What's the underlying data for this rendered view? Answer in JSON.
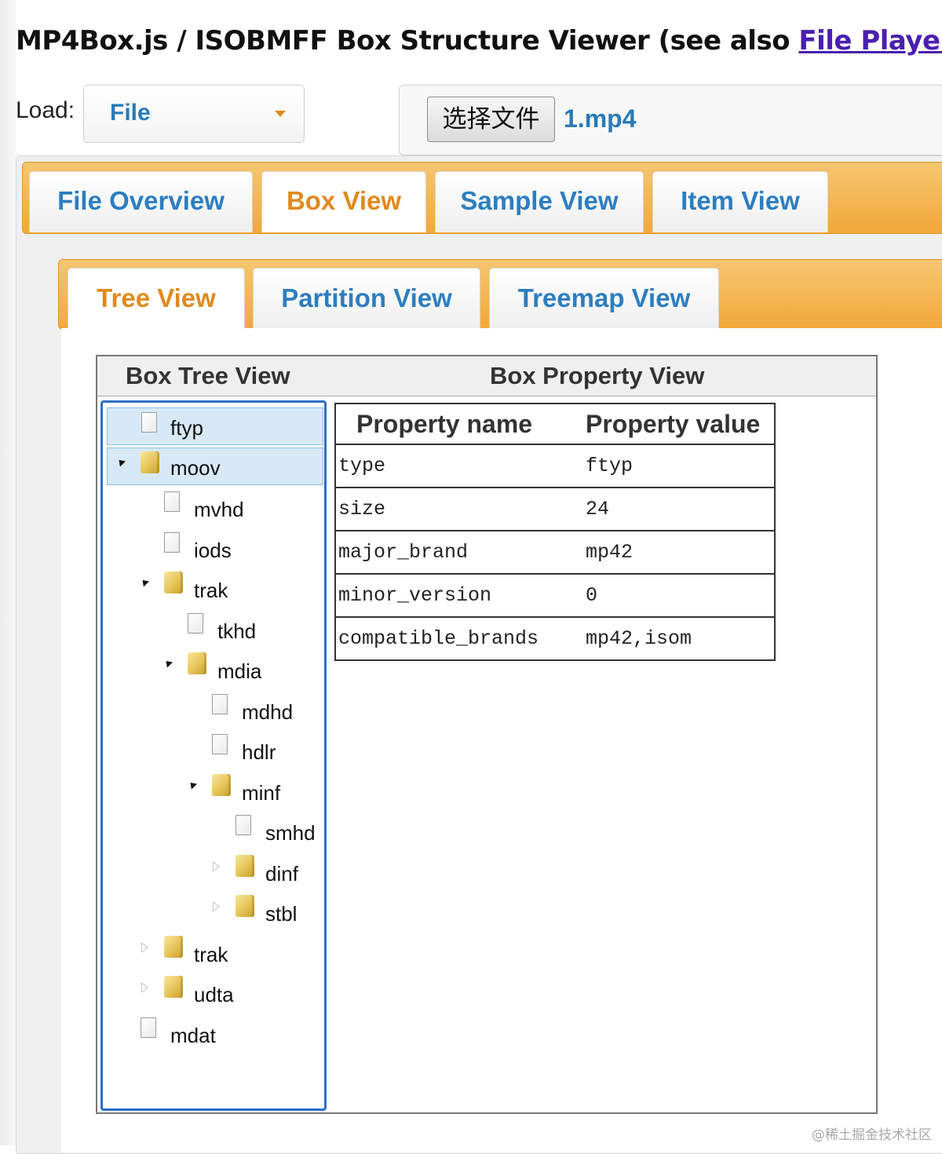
{
  "header": {
    "title": "MP4Box.js / ISOBMFF Box Structure Viewer (see also ",
    "player_link": "File Player",
    "title_close": ")"
  },
  "load": {
    "label": "Load:",
    "selected": "File",
    "file_button": "选择文件",
    "file_name": "1.mp4"
  },
  "main_tabs": [
    {
      "label": "File Overview",
      "active": false
    },
    {
      "label": "Box View",
      "active": true
    },
    {
      "label": "Sample View",
      "active": false
    },
    {
      "label": "Item View",
      "active": false
    }
  ],
  "sub_tabs": [
    {
      "label": "Tree View",
      "active": true
    },
    {
      "label": "Partition View",
      "active": false
    },
    {
      "label": "Treemap View",
      "active": false
    }
  ],
  "viewer": {
    "tree_header": "Box Tree View",
    "property_header": "Box Property View"
  },
  "tree": [
    {
      "label": "ftyp",
      "type": "file",
      "depth": 0,
      "twisty": "none",
      "selected": true
    },
    {
      "label": "moov",
      "type": "folder",
      "depth": 0,
      "twisty": "open",
      "selected": true
    },
    {
      "label": "mvhd",
      "type": "file",
      "depth": 1,
      "twisty": "none",
      "selected": false
    },
    {
      "label": "iods",
      "type": "file",
      "depth": 1,
      "twisty": "none",
      "selected": false
    },
    {
      "label": "trak",
      "type": "folder",
      "depth": 1,
      "twisty": "open",
      "selected": false
    },
    {
      "label": "tkhd",
      "type": "file",
      "depth": 2,
      "twisty": "none",
      "selected": false
    },
    {
      "label": "mdia",
      "type": "folder",
      "depth": 2,
      "twisty": "open",
      "selected": false
    },
    {
      "label": "mdhd",
      "type": "file",
      "depth": 3,
      "twisty": "none",
      "selected": false
    },
    {
      "label": "hdlr",
      "type": "file",
      "depth": 3,
      "twisty": "none",
      "selected": false
    },
    {
      "label": "minf",
      "type": "folder",
      "depth": 3,
      "twisty": "open",
      "selected": false
    },
    {
      "label": "smhd",
      "type": "file",
      "depth": 4,
      "twisty": "none",
      "selected": false
    },
    {
      "label": "dinf",
      "type": "folder",
      "depth": 4,
      "twisty": "closed",
      "selected": false
    },
    {
      "label": "stbl",
      "type": "folder",
      "depth": 4,
      "twisty": "closed",
      "selected": false
    },
    {
      "label": "trak",
      "type": "folder",
      "depth": 1,
      "twisty": "closed",
      "selected": false
    },
    {
      "label": "udta",
      "type": "folder",
      "depth": 1,
      "twisty": "closed",
      "selected": false
    },
    {
      "label": "mdat",
      "type": "file",
      "depth": 0,
      "twisty": "none",
      "selected": false
    }
  ],
  "properties": {
    "col_name": "Property name",
    "col_value": "Property value",
    "rows": [
      {
        "name": "type",
        "value": "ftyp"
      },
      {
        "name": "size",
        "value": "24"
      },
      {
        "name": "major_brand",
        "value": "mp42"
      },
      {
        "name": "minor_version",
        "value": "0"
      },
      {
        "name": "compatible_brands",
        "value": "mp42,isom"
      }
    ]
  },
  "watermark": "@稀土掘金技术社区"
}
